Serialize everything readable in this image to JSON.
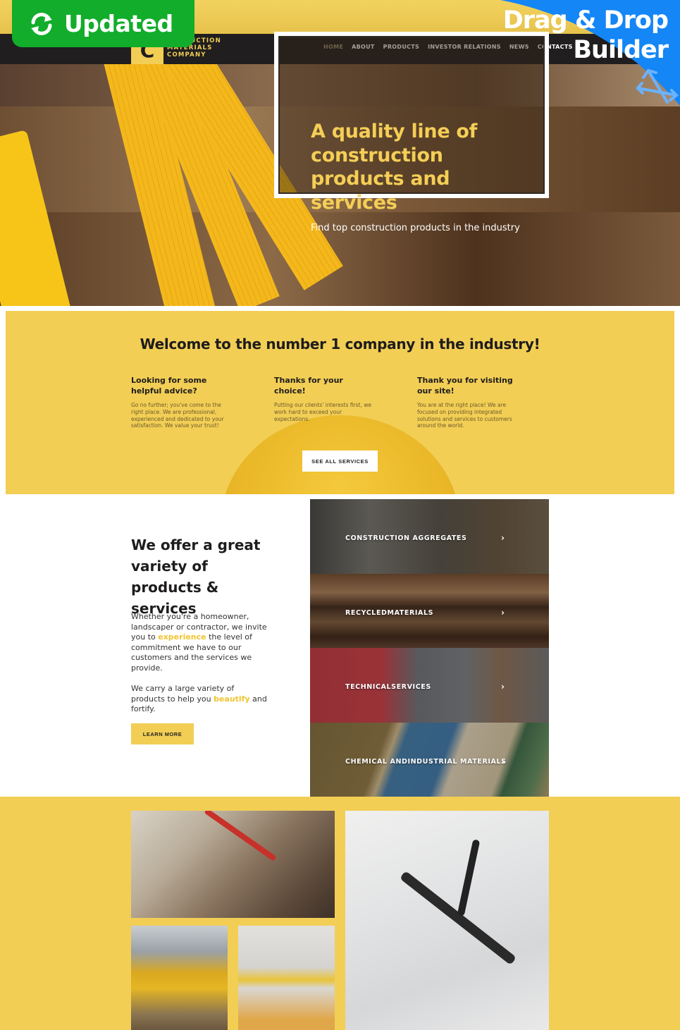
{
  "badges": {
    "updated_label": "Updated",
    "updated_icon": "refresh-icon",
    "builder_line1": "Drag & Drop",
    "builder_line2": "Builder",
    "builder_icon": "move-arrows-icon",
    "updated_color": "#12ad2b",
    "builder_color": "#1486f5"
  },
  "brand": {
    "logo_letter": "C",
    "name_line1": "CONSTRUCTION",
    "name_line1_visible": "UCTION",
    "name_line2": "MATERIALS",
    "name_line3": "COMPANY",
    "accent_color": "#f2ce55",
    "nav_bg": "#201e1f"
  },
  "nav": {
    "items": [
      {
        "label": "HOME",
        "active": true
      },
      {
        "label": "ABOUT",
        "active": false
      },
      {
        "label": "PRODUCTS",
        "active": false
      },
      {
        "label": "INVESTOR RELATIONS",
        "active": false
      },
      {
        "label": "NEWS",
        "active": false
      },
      {
        "label": "CONTACTS",
        "active": false
      }
    ]
  },
  "hero": {
    "title": "A quality line of construction products and services",
    "subtitle": "Find top construction products in the industry"
  },
  "welcome": {
    "title": "Welcome to the number 1 company in the industry!",
    "columns": [
      {
        "title": "Looking for some helpful advice?",
        "text": "Go no further; you've come to the right place. We are professional, experienced and dedicated to your satisfaction. We value your trust!"
      },
      {
        "title": "Thanks for your choice!",
        "text": "Putting our clients' interests first, we work hard to exceed your expectations."
      },
      {
        "title": "Thank you for visiting our site!",
        "text": "You are at the right place! We are focused on providing integrated solutions and services to customers around the world."
      }
    ],
    "button_label": "SEE ALL SERVICES"
  },
  "offer": {
    "title": "We offer a great variety of products & services",
    "p1_before": "Whether you're a homeowner, landscaper or contractor, we invite you to ",
    "p1_highlight": "experience",
    "p1_after": " the level of commitment we have to our customers and the services we provide.",
    "p2_before": "We carry a large variety of products to help you ",
    "p2_highlight": "beautify",
    "p2_after": " and fortify.",
    "button_label": "LEARN MORE"
  },
  "services": [
    {
      "label": "CONSTRUCTION AGGREGATES",
      "icon": "chevron-right-icon"
    },
    {
      "label": "RECYCLEDMATERIALS",
      "icon": "chevron-right-icon"
    },
    {
      "label": "TECHNICALSERVICES",
      "icon": "chevron-right-icon"
    },
    {
      "label": "CHEMICAL ANDINDUSTRIAL MATERIALS",
      "icon": "chevron-right-icon"
    }
  ],
  "gallery": {
    "photos": [
      "carpenter-marking-wood",
      "bulldozer",
      "spirit-level-gloves",
      "tools-on-blueprints"
    ]
  }
}
